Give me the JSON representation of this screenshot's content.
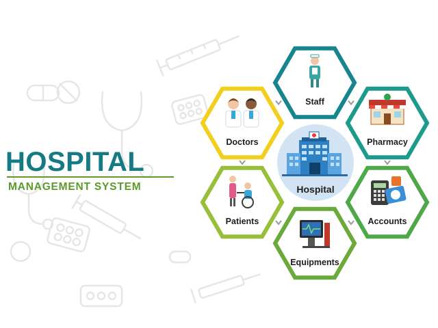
{
  "title": {
    "main": "HOSPITAL",
    "sub": "MANAGEMENT SYSTEM",
    "main_color": "#157a84",
    "sub_color": "#5a9a2a",
    "underline_color": "#5a9a2a"
  },
  "center": {
    "label": "Hospital",
    "circle_color": "#d2e3f4"
  },
  "modules": [
    {
      "id": "staff",
      "label": "Staff",
      "color": "#17858d",
      "icon": "nurse-icon"
    },
    {
      "id": "pharmacy",
      "label": "Pharmacy",
      "color": "#1c9b8c",
      "icon": "pharmacy-store-icon"
    },
    {
      "id": "accounts",
      "label": "Accounts",
      "color": "#4ea84a",
      "icon": "calculator-money-icon"
    },
    {
      "id": "equipments",
      "label": "Equipments",
      "color": "#6aaa3a",
      "icon": "medical-monitor-icon"
    },
    {
      "id": "patients",
      "label": "Patients",
      "color": "#98bf3a",
      "icon": "wheelchair-patient-icon"
    },
    {
      "id": "doctors",
      "label": "Doctors",
      "color": "#f2cf1c",
      "icon": "doctors-icon"
    }
  ],
  "decorations": [
    "syringe-icon",
    "stethoscope-icon",
    "pill-icon",
    "blister-pack-icon"
  ]
}
